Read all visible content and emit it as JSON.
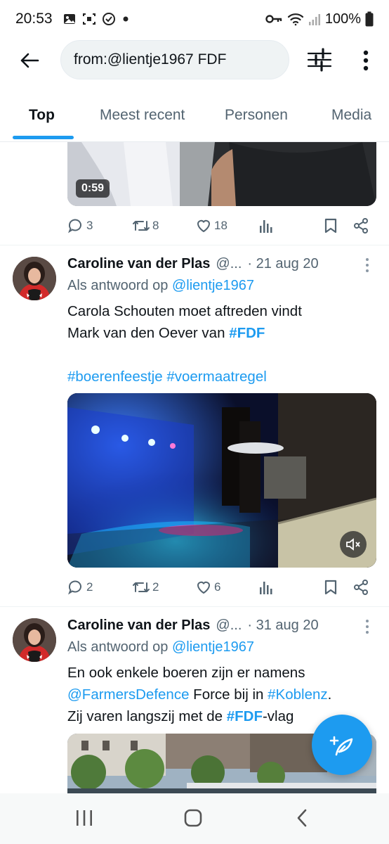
{
  "status_bar": {
    "time": "20:53",
    "battery": "100%",
    "left_icons": [
      "gallery-icon",
      "screenshot-icon",
      "check-circle-icon",
      "dot-icon"
    ],
    "right_icons": [
      "key-icon",
      "wifi-icon",
      "signal-icon",
      "battery-icon"
    ]
  },
  "search": {
    "query": "from:@lientje1967 FDF"
  },
  "tabs": [
    {
      "label": "Top",
      "active": true
    },
    {
      "label": "Meest recent",
      "active": false
    },
    {
      "label": "Personen",
      "active": false
    },
    {
      "label": "Media",
      "active": false
    }
  ],
  "prev_tweet": {
    "video_duration": "0:59",
    "replies": "3",
    "retweets": "8",
    "likes": "18"
  },
  "tweets": [
    {
      "author": "Caroline van der Plas",
      "handle": "@...",
      "date": "· 21 aug 20",
      "reply_prefix": "Als antwoord op",
      "reply_to": "@lientje1967",
      "text_1": "Carola Schouten moet aftreden vindt",
      "text_2": "Mark van den Oever van",
      "hashtag_1": "#FDF",
      "hashtag_2": "#boerenfeestje",
      "hashtag_3": "#voermaatregel",
      "replies": "2",
      "retweets": "2",
      "likes": "6"
    },
    {
      "author": "Caroline van der Plas",
      "handle": "@...",
      "date": "· 31 aug 20",
      "reply_prefix": "Als antwoord op",
      "reply_to": "@lientje1967",
      "text_1": "En ook enkele boeren zijn er namens",
      "mention": "@FarmersDefence",
      "text_2": " Force bij in ",
      "hashtag_1": "#Koblenz",
      "text_3": ".",
      "text_4": "Zij varen langszij met de ",
      "hashtag_2": "#FDF",
      "text_5": "-vlag"
    }
  ],
  "colors": {
    "accent": "#1d9bf0",
    "text_primary": "#0f1419",
    "text_secondary": "#536471",
    "divider": "#eff3f4"
  }
}
